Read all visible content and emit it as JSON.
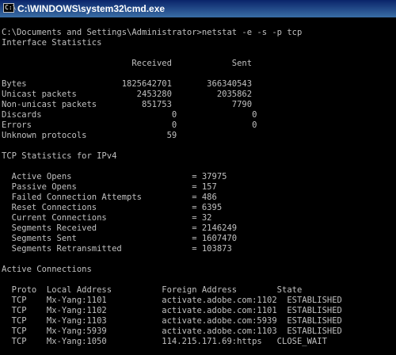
{
  "window": {
    "title": "C:\\WINDOWS\\system32\\cmd.exe",
    "background_color": "#000000",
    "text_color": "#c0c0c0"
  },
  "console": {
    "lines": [
      "",
      "C:\\Documents and Settings\\Administrator>netstat -e -s -p tcp",
      "Interface Statistics",
      "",
      "                          Received            Sent",
      "",
      "Bytes                   1825642701       366340543",
      "Unicast packets            2453280         2035862",
      "Non-unicast packets         851753            7790",
      "Discards                          0               0",
      "Errors                            0               0",
      "Unknown protocols                59",
      "",
      "TCP Statistics for IPv4",
      "",
      "  Active Opens                        = 37975",
      "  Passive Opens                       = 157",
      "  Failed Connection Attempts          = 486",
      "  Reset Connections                   = 6395",
      "  Current Connections                 = 32",
      "  Segments Received                   = 2146249",
      "  Segments Sent                       = 1607470",
      "  Segments Retransmitted              = 103873",
      "",
      "Active Connections",
      "",
      "  Proto  Local Address          Foreign Address        State",
      "  TCP    Mx-Yang:1101           activate.adobe.com:1102  ESTABLISHED",
      "  TCP    Mx-Yang:1102           activate.adobe.com:1101  ESTABLISHED",
      "  TCP    Mx-Yang:1103           activate.adobe.com:5939  ESTABLISHED",
      "  TCP    Mx-Yang:5939           activate.adobe.com:1103  ESTABLISHED",
      "  TCP    Mx-Yang:1050           114.215.171.69:https   CLOSE_WAIT"
    ]
  }
}
